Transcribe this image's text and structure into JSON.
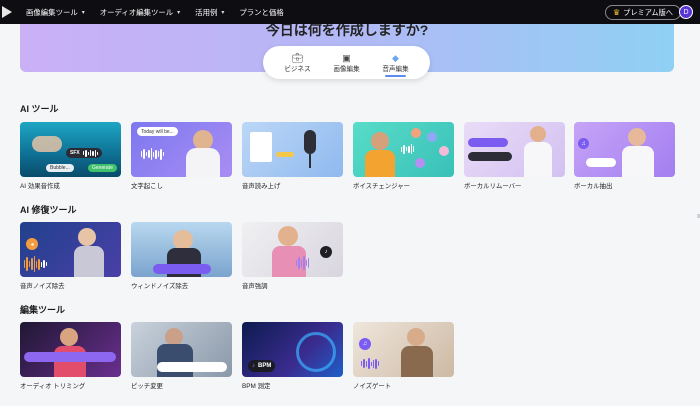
{
  "nav": {
    "items": [
      {
        "label": "画像編集ツール",
        "has_dropdown": true
      },
      {
        "label": "オーディオ編集ツール",
        "has_dropdown": true
      },
      {
        "label": "活用例",
        "has_dropdown": true
      },
      {
        "label": "プランと価格",
        "has_dropdown": false
      }
    ],
    "premium_label": "プレミアム版へ",
    "avatar_initial": "D"
  },
  "hero": {
    "title": "今日は何を作成しますか?",
    "tabs": [
      {
        "label": "ビジネス",
        "icon": "briefcase-icon"
      },
      {
        "label": "画像編集",
        "icon": "image-icon"
      },
      {
        "label": "音声編集",
        "icon": "audio-diamond-icon",
        "active": true
      }
    ]
  },
  "sections": [
    {
      "title": "AI ツール",
      "cards": [
        {
          "label": "AI 効果音作成",
          "thumb_text": [
            "SFX",
            "Bubble...",
            "Generate"
          ]
        },
        {
          "label": "文字起こし",
          "thumb_text": [
            "Today will be..."
          ]
        },
        {
          "label": "音声読み上げ"
        },
        {
          "label": "ボイスチェンジャー"
        },
        {
          "label": "ボーカルリムーバー"
        },
        {
          "label": "ボーカル抽出"
        }
      ]
    },
    {
      "title": "AI 修復ツール",
      "cards": [
        {
          "label": "音声ノイズ除去"
        },
        {
          "label": "ウィンドノイズ除去"
        },
        {
          "label": "音声強調"
        }
      ]
    },
    {
      "title": "編集ツール",
      "cards": [
        {
          "label": "オーディオ トリミング"
        },
        {
          "label": "ピッチ変更"
        },
        {
          "label": "BPM 測定",
          "thumb_text": [
            "BPM"
          ]
        },
        {
          "label": "ノイズゲート"
        }
      ]
    }
  ],
  "colors": {
    "nav_bg": "#0e0e12",
    "accent": "#5b8cf0",
    "avatar": "#5a35d8",
    "crown": "#f4c430"
  }
}
